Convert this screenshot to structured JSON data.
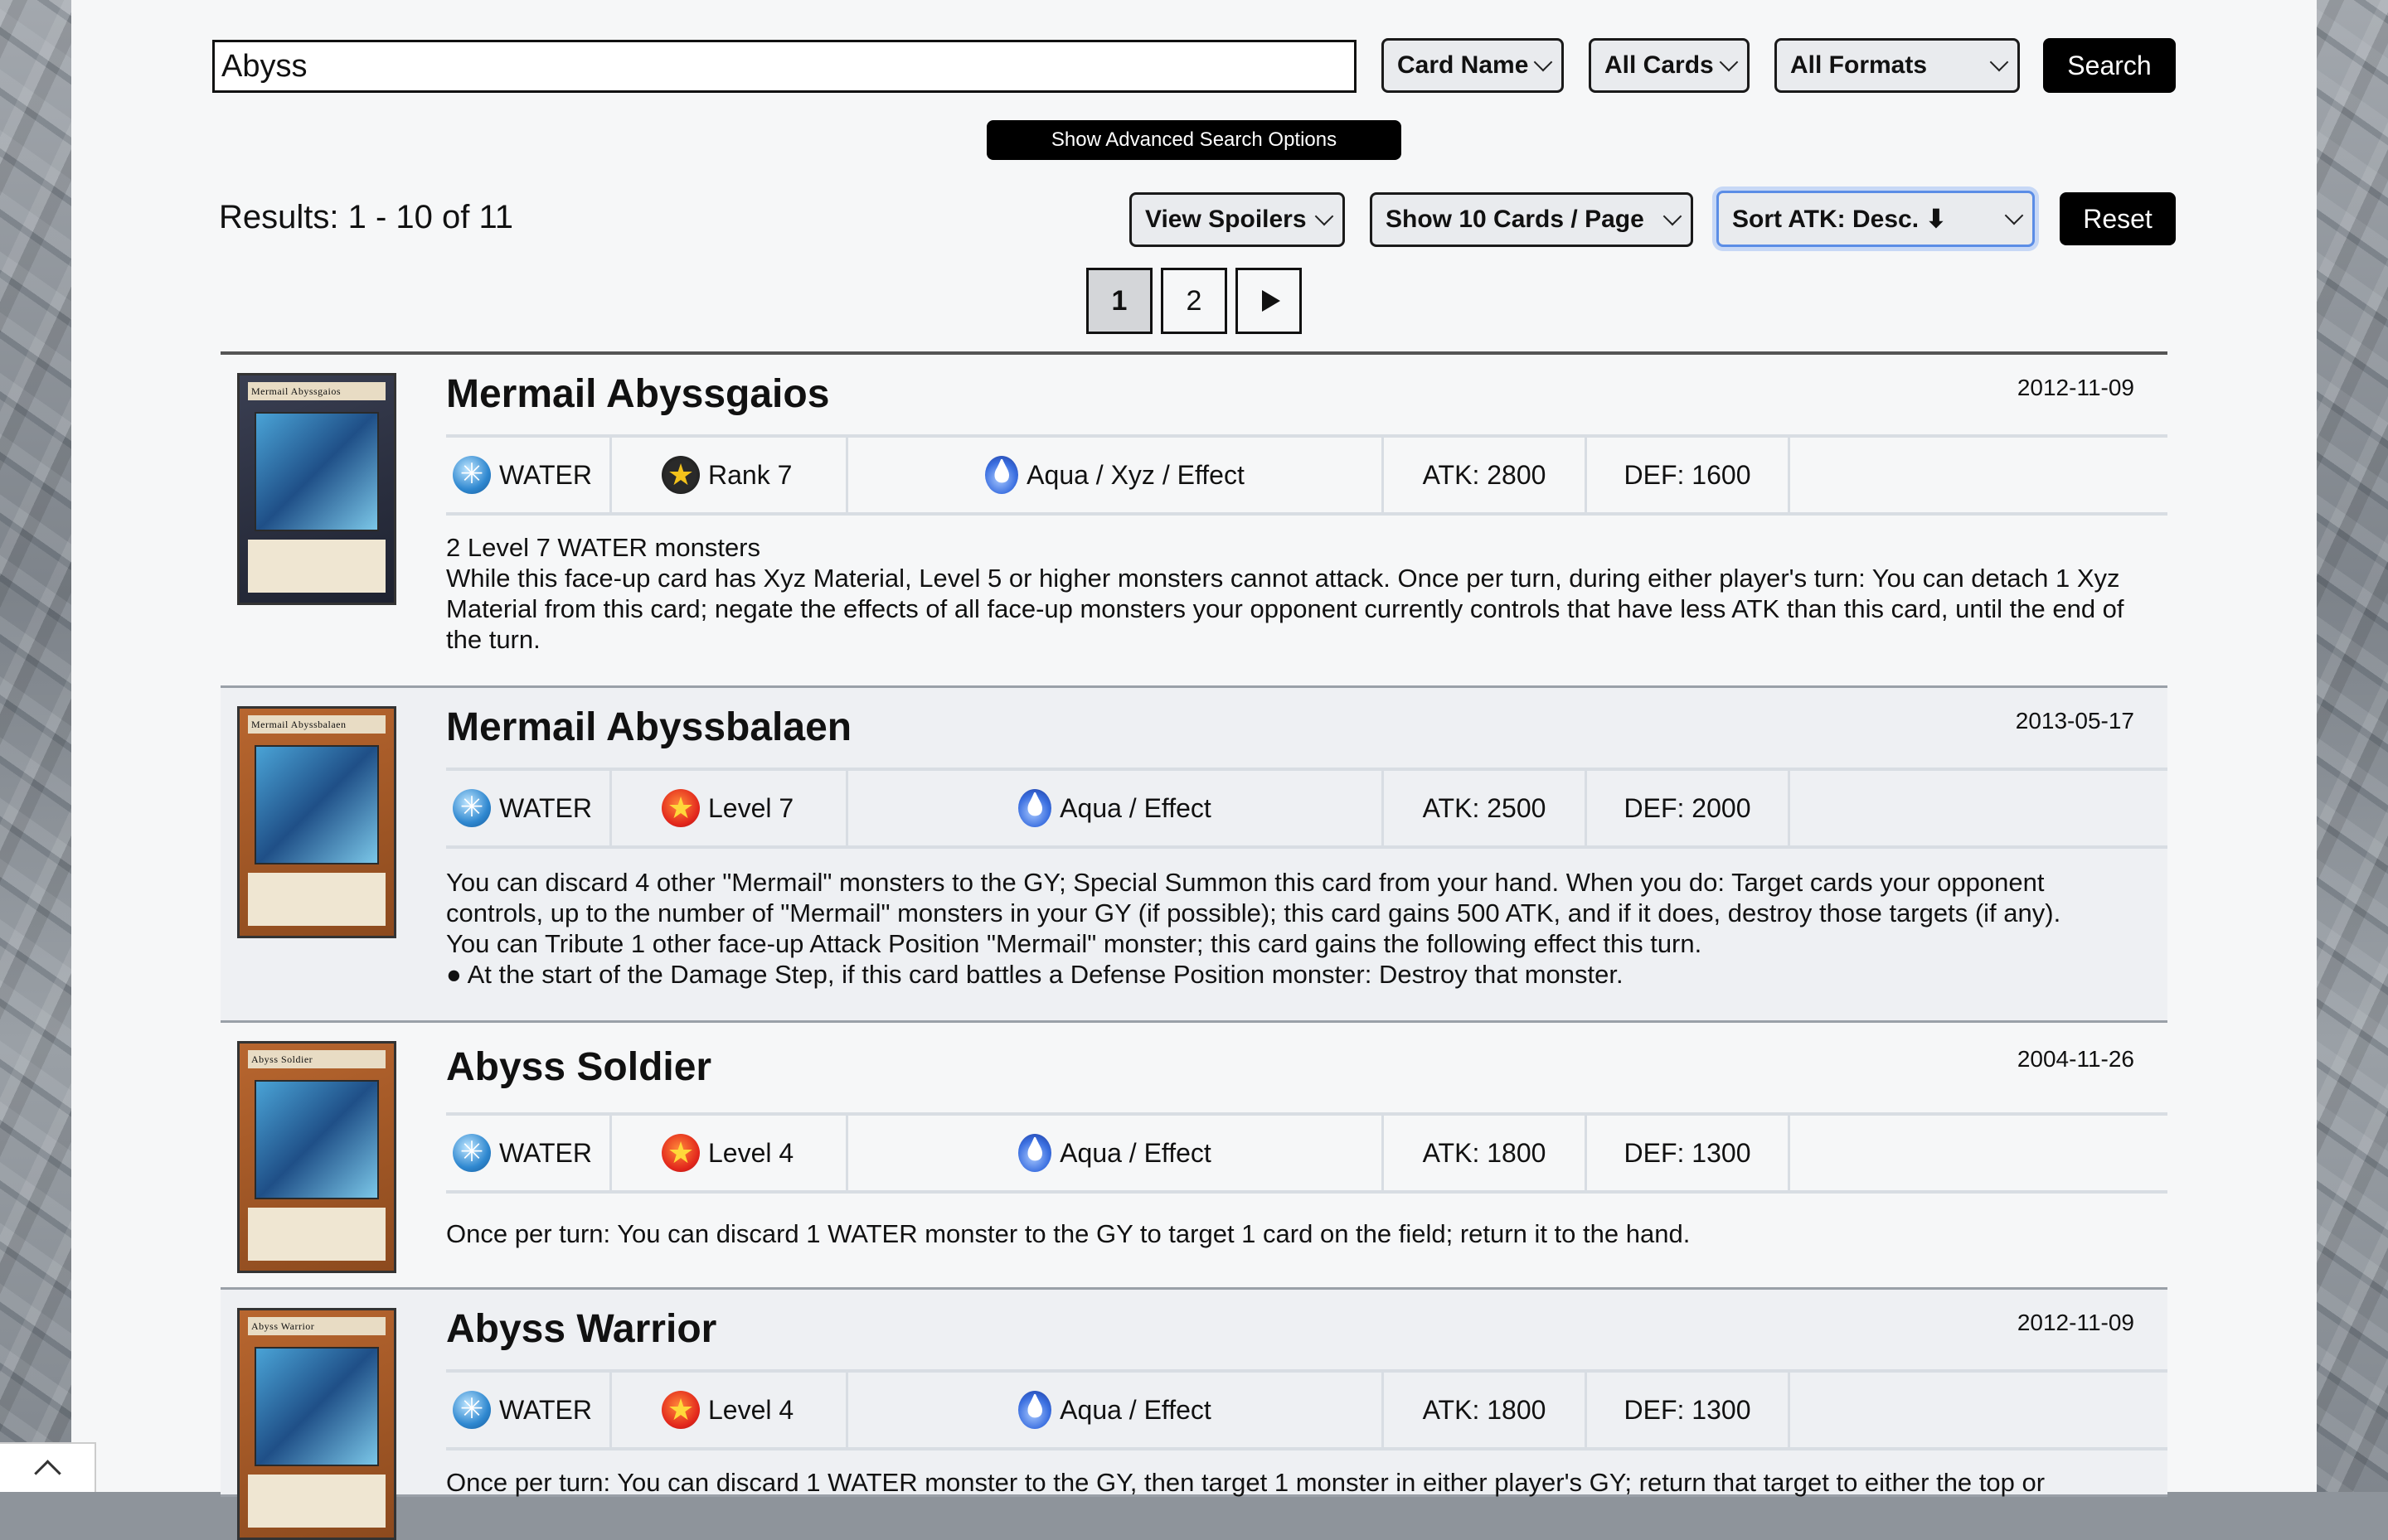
{
  "search": {
    "query": "Abyss",
    "field_select": "Card Name",
    "category_select": "All Cards",
    "format_select": "All Formats",
    "search_label": "Search",
    "advanced_label": "Show Advanced Search Options"
  },
  "results": {
    "summary": "Results: 1 - 10 of 11",
    "view_select": "View Spoilers",
    "per_page_select": "Show 10 Cards / Page",
    "sort_select": "Sort ATK: Desc. ⬇",
    "reset_label": "Reset"
  },
  "pagination": {
    "pages": [
      "1",
      "2"
    ],
    "current": "1"
  },
  "cards": [
    {
      "name": "Mermail Abyssgaios",
      "thumb_name": "Mermail Abyssgaios",
      "date": "2012-11-09",
      "attribute": "WATER",
      "level": "Rank 7",
      "type": "Aqua / Xyz / Effect",
      "atk": "ATK: 2800",
      "def": "DEF: 1600",
      "desc": [
        "2 Level 7 WATER monsters",
        "While this face-up card has Xyz Material, Level 5 or higher monsters cannot attack. Once per turn, during either player's turn: You can detach 1 Xyz Material from this card; negate the effects of all face-up monsters your opponent currently controls that have less ATK than this card, until the end of the turn."
      ]
    },
    {
      "name": "Mermail Abyssbalaen",
      "thumb_name": "Mermail Abyssbalaen",
      "date": "2013-05-17",
      "attribute": "WATER",
      "level": "Level 7",
      "type": "Aqua / Effect",
      "atk": "ATK: 2500",
      "def": "DEF: 2000",
      "desc": [
        "You can discard 4 other \"Mermail\" monsters to the GY; Special Summon this card from your hand. When you do: Target cards your opponent controls, up to the number of \"Mermail\" monsters in your GY (if possible); this card gains 500 ATK, and if it does, destroy those targets (if any).",
        "You can Tribute 1 other face-up Attack Position \"Mermail\" monster; this card gains the following effect this turn.",
        "● At the start of the Damage Step, if this card battles a Defense Position monster: Destroy that monster."
      ]
    },
    {
      "name": "Abyss Soldier",
      "thumb_name": "Abyss Soldier",
      "date": "2004-11-26",
      "attribute": "WATER",
      "level": "Level 4",
      "type": "Aqua / Effect",
      "atk": "ATK: 1800",
      "def": "DEF: 1300",
      "desc": [
        "Once per turn: You can discard 1 WATER monster to the GY to target 1 card on the field; return it to the hand."
      ]
    },
    {
      "name": "Abyss Warrior",
      "thumb_name": "Abyss Warrior",
      "date": "2012-11-09",
      "attribute": "WATER",
      "level": "Level 4",
      "type": "Aqua / Effect",
      "atk": "ATK: 1800",
      "def": "DEF: 1300",
      "desc": [
        "Once per turn: You can discard 1 WATER monster to the GY, then target 1 monster in either player's GY; return that target to either the top or"
      ]
    }
  ]
}
